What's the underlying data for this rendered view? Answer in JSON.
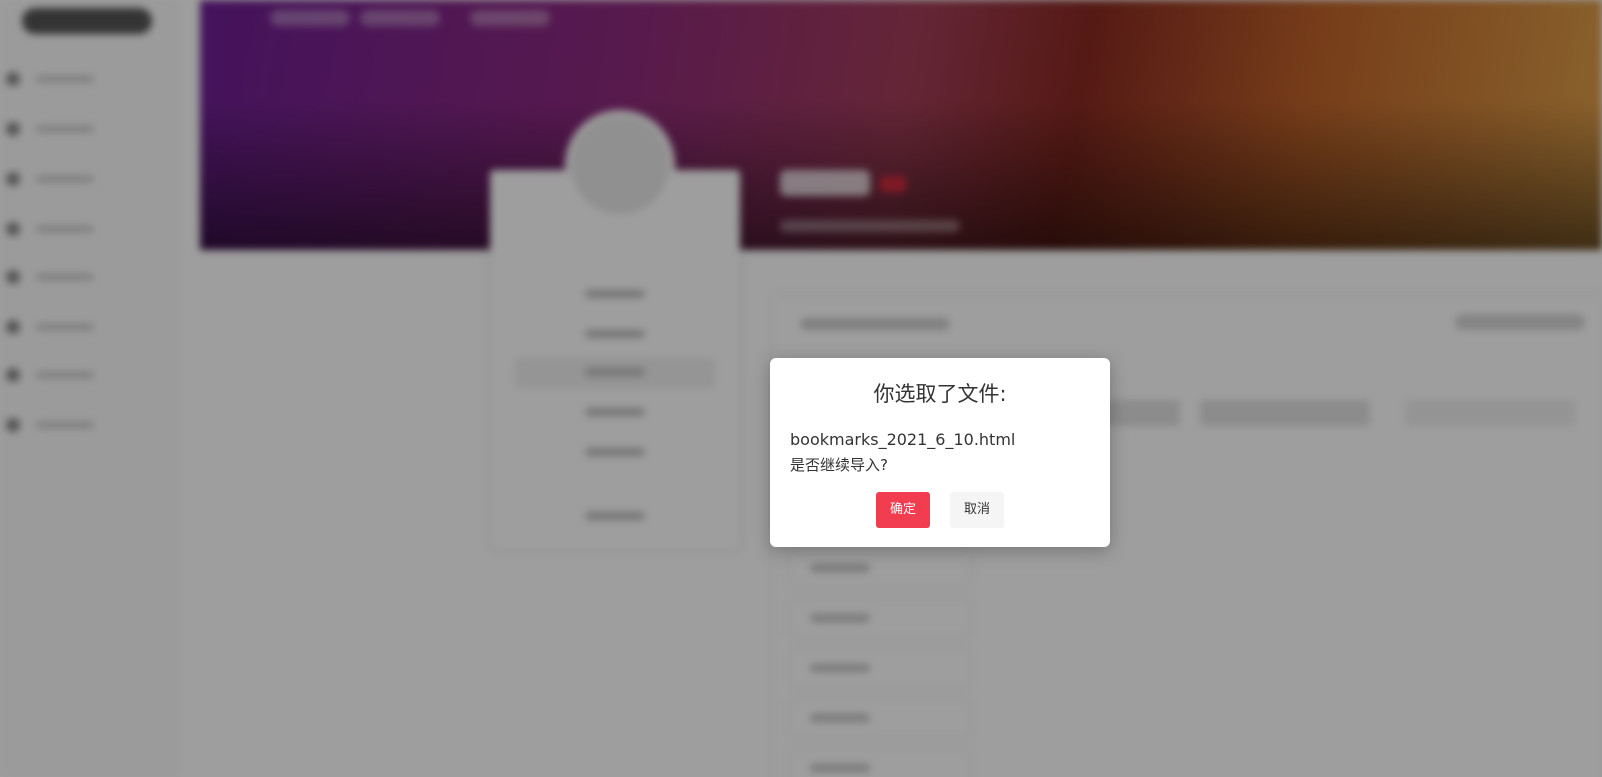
{
  "dialog": {
    "title": "你选取了文件:",
    "filename": "bookmarks_2021_6_10.html",
    "question": "是否继续导入?",
    "confirm_label": "确定",
    "cancel_label": "取消"
  },
  "colors": {
    "accent": "#f23c50",
    "overlay": "rgba(0,0,0,0.38)"
  }
}
